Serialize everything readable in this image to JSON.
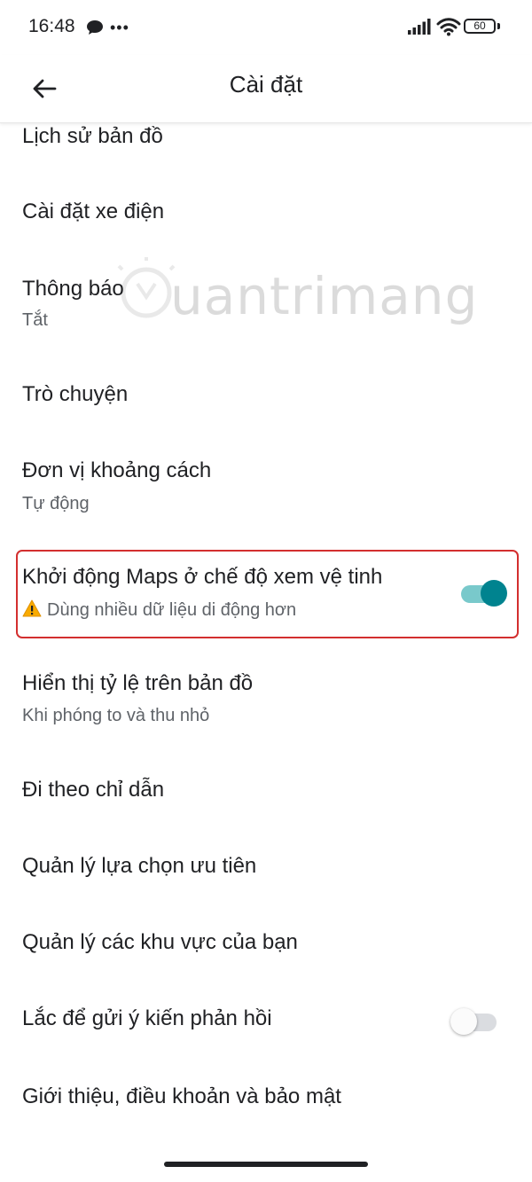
{
  "status_bar": {
    "time": "16:48",
    "battery": "60"
  },
  "header": {
    "title": "Cài đặt"
  },
  "settings": [
    {
      "title": "Lịch sử bản đồ"
    },
    {
      "title": "Cài đặt xe điện"
    },
    {
      "title": "Thông báo",
      "subtitle": "Tắt"
    },
    {
      "title": "Trò chuyện"
    },
    {
      "title": "Đơn vị khoảng cách",
      "subtitle": "Tự động"
    },
    {
      "title": "Khởi động Maps ở chế độ xem vệ tinh",
      "subtitle": "Dùng nhiều dữ liệu di động hơn",
      "toggle": "on"
    },
    {
      "title": "Hiển thị tỷ lệ trên bản đồ",
      "subtitle": "Khi phóng to và thu nhỏ"
    },
    {
      "title": "Đi theo chỉ dẫn"
    },
    {
      "title": "Quản lý lựa chọn ưu tiên"
    },
    {
      "title": "Quản lý các khu vực của bạn"
    },
    {
      "title": "Lắc để gửi ý kiến phản hồi",
      "toggle": "off"
    },
    {
      "title": "Giới thiệu, điều khoản và bảo mật"
    }
  ],
  "watermark": "uantrimang",
  "colors": {
    "toggle_on_thumb": "#00838f",
    "toggle_on_track": "#79c9cb",
    "highlight_border": "#d32f2f",
    "warning": "#f9ab00"
  }
}
